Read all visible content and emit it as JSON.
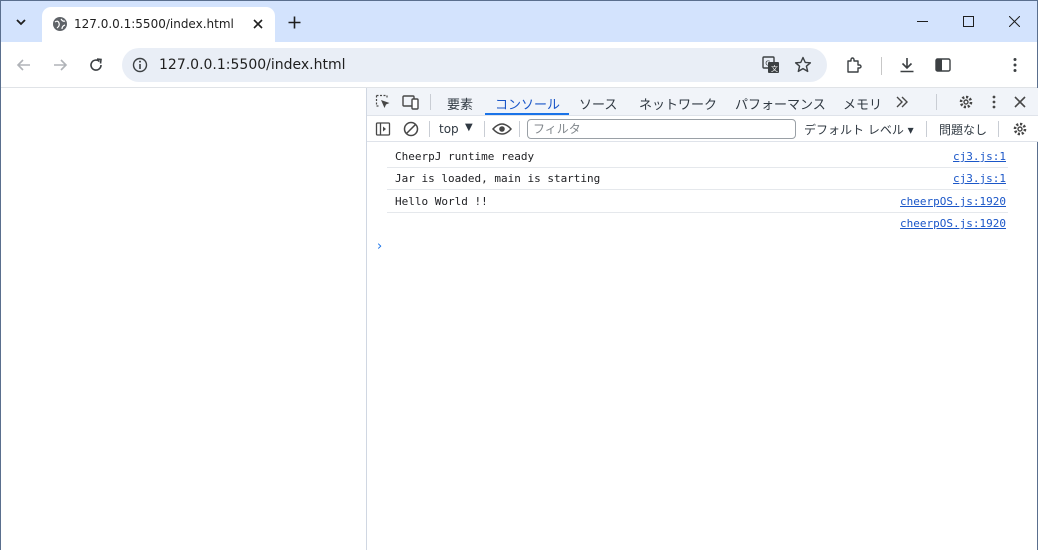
{
  "tab": {
    "title": "127.0.0.1:5500/index.html",
    "favicon": "globe-icon"
  },
  "omnibox": {
    "url": "127.0.0.1:5500/index.html"
  },
  "devtools": {
    "tabs": [
      {
        "label": "要素"
      },
      {
        "label": "コンソール"
      },
      {
        "label": "ソース"
      },
      {
        "label": "ネットワーク"
      },
      {
        "label": "パフォーマンス"
      },
      {
        "label": "メモリ"
      }
    ],
    "active_tab": "コンソール",
    "context": "top",
    "filter_placeholder": "フィルタ",
    "level_label": "デフォルト レベル ▾",
    "issues_label": "問題なし",
    "messages": [
      {
        "text": "CheerpJ runtime ready",
        "source": "cj3.js:1"
      },
      {
        "text": "Jar is loaded, main is starting",
        "source": "cj3.js:1"
      },
      {
        "text": "Hello World !!",
        "source": "cheerpOS.js:1920"
      },
      {
        "text": "",
        "source": "cheerpOS.js:1920"
      }
    ],
    "prompt": "›"
  },
  "colors": {
    "tabstrip": "#d3e3fd",
    "accent": "#1a73e8",
    "link": "#1a56c8"
  }
}
